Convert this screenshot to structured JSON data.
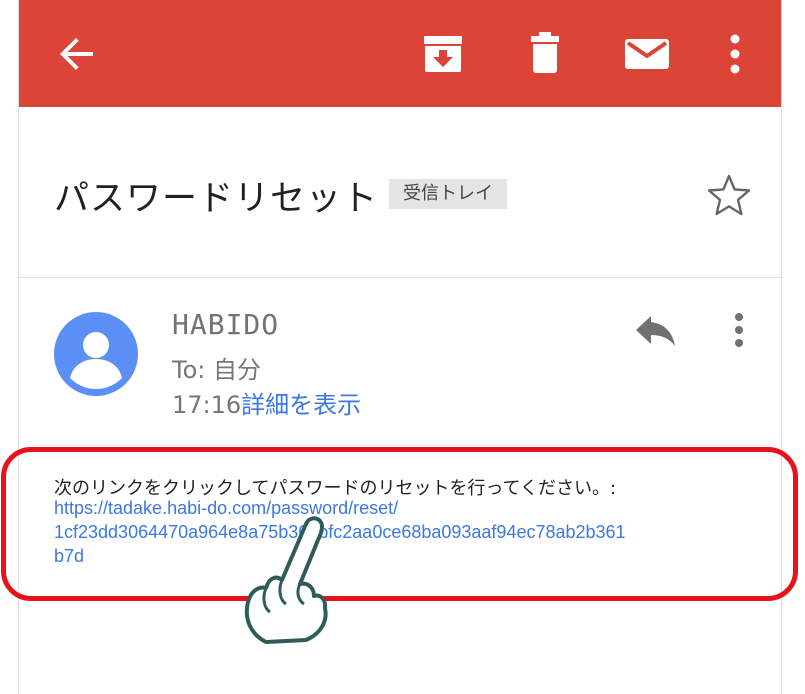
{
  "toolbar": {
    "back_icon": "arrow-back-icon",
    "archive_icon": "archive-icon",
    "delete_icon": "trash-icon",
    "mail_icon": "mail-icon",
    "more_icon": "more-vert-icon",
    "background_color": "#db4437"
  },
  "email": {
    "subject": "パスワードリセット",
    "label": "受信トレイ",
    "sender_name": "HABIDO",
    "to_prefix": "To: ",
    "to_value": "自分",
    "time": "17:16",
    "details_link": "詳細を表示",
    "body_text": "次のリンクをクリックしてパスワードのリセットを行ってください。:",
    "link_lines": [
      "https://tadake.habi-do.com/password/reset/",
      "1cf23dd3064470a964e8a75b362bfc2aa0ce68ba093aaf94ec78ab2b361",
      "b7d"
    ]
  },
  "colors": {
    "link": "#3b78e7",
    "avatar": "#5b8ff5",
    "highlight": "#e8121a"
  }
}
